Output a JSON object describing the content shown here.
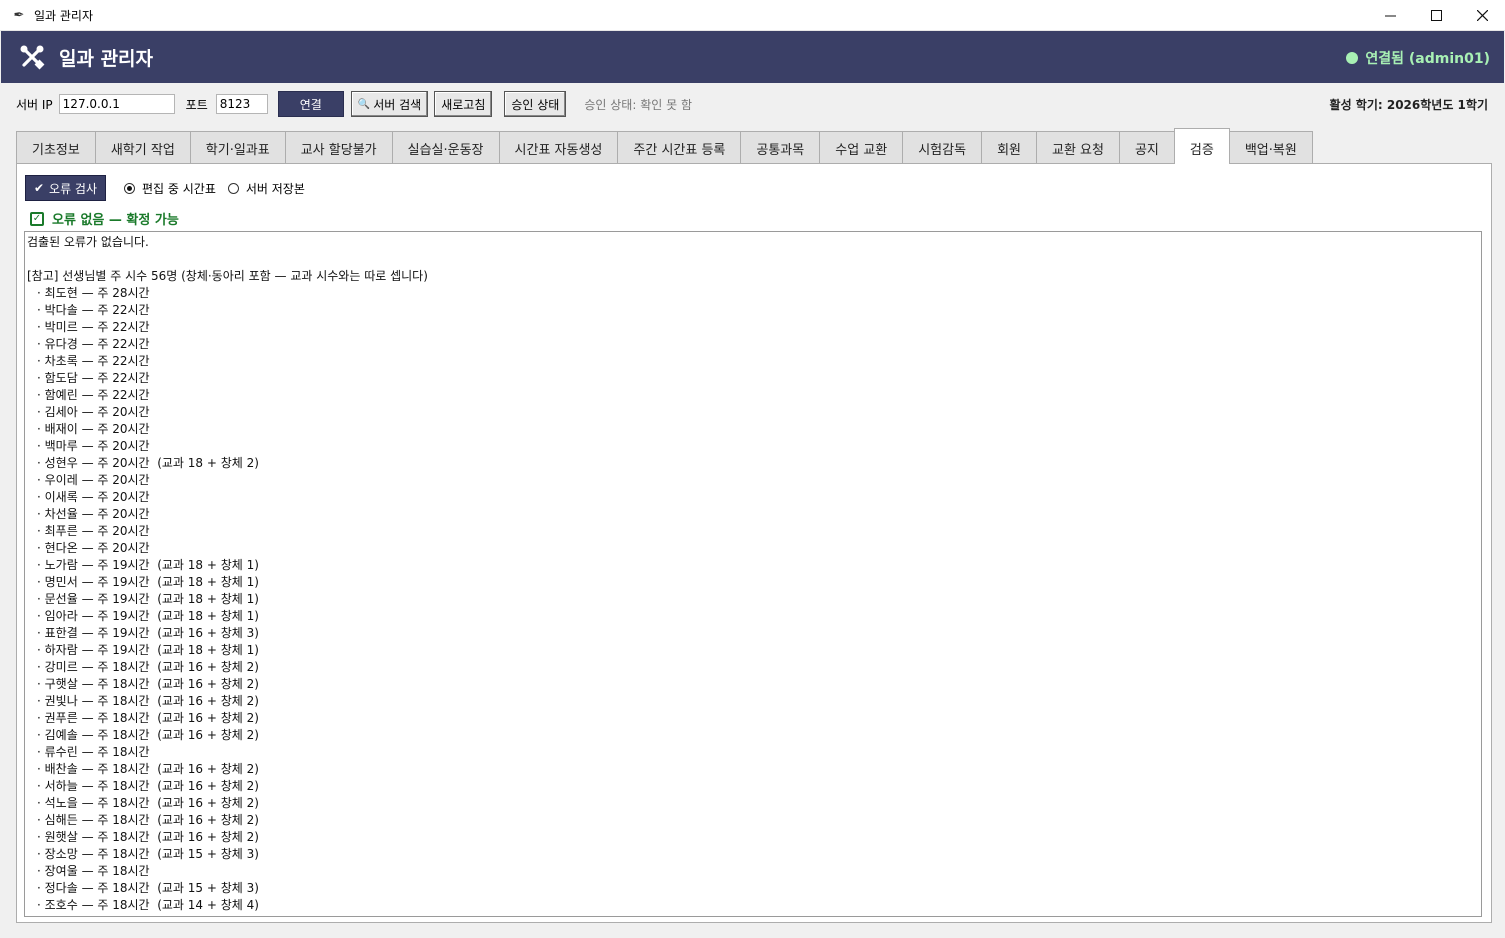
{
  "window": {
    "title": "일과 관리자",
    "icons": {
      "app": "feather-icon",
      "minimize": "minimize-icon",
      "maximize": "maximize-icon",
      "close": "close-icon"
    }
  },
  "header": {
    "title": "일과 관리자",
    "logo_icon": "tools-icon",
    "status": "연결됨 (admin01)",
    "status_color": "#a8f0b4",
    "bg_color": "#3a3f66"
  },
  "toolbar": {
    "server_ip_label": "서버 IP",
    "server_ip_value": "127.0.0.1",
    "port_label": "포트",
    "port_value": "8123",
    "connect_label": "연결",
    "search_server_label": "서버 검색",
    "refresh_label": "새로고침",
    "approval_button_label": "승인 상태",
    "approval_status": "승인 상태: 확인 못 함",
    "active_semester": "활성 학기: 2026학년도 1학기"
  },
  "tabs": [
    {
      "label": "기초정보"
    },
    {
      "label": "새학기 작업"
    },
    {
      "label": "학기·일과표"
    },
    {
      "label": "교사 할당불가"
    },
    {
      "label": "실습실·운동장"
    },
    {
      "label": "시간표 자동생성"
    },
    {
      "label": "주간 시간표 등록"
    },
    {
      "label": "공통과목"
    },
    {
      "label": "수업 교환"
    },
    {
      "label": "시험감독"
    },
    {
      "label": "회원"
    },
    {
      "label": "교환 요청"
    },
    {
      "label": "공지"
    },
    {
      "label": "검증"
    },
    {
      "label": "백업·복원"
    }
  ],
  "active_tab": "검증",
  "validation": {
    "check_button_label": "오류 검사",
    "radio_editing": "편집 중 시간표",
    "radio_server": "서버 저장본",
    "selected": "editing",
    "result_label": "오류 없음 — 확정 가능",
    "result_color": "#1a7a2a",
    "output_header": "검출된 오류가 없습니다.",
    "output_note": "[참고] 선생님별 주 시수 56명 (창체·동아리 포함 — 교과 시수와는 따로 셉니다)",
    "output_lines": [
      "· 최도현 — 주 28시간",
      "· 박다솔 — 주 22시간",
      "· 박미르 — 주 22시간",
      "· 유다경 — 주 22시간",
      "· 차초록 — 주 22시간",
      "· 함도담 — 주 22시간",
      "· 함예린 — 주 22시간",
      "· 김세아 — 주 20시간",
      "· 배재이 — 주 20시간",
      "· 백마루 — 주 20시간",
      "· 성현우 — 주 20시간  (교과 18 + 창체 2)",
      "· 우이레 — 주 20시간",
      "· 이새록 — 주 20시간",
      "· 차선율 — 주 20시간",
      "· 최푸른 — 주 20시간",
      "· 현다온 — 주 20시간",
      "· 노가람 — 주 19시간  (교과 18 + 창체 1)",
      "· 명민서 — 주 19시간  (교과 18 + 창체 1)",
      "· 문선율 — 주 19시간  (교과 18 + 창체 1)",
      "· 임아라 — 주 19시간  (교과 18 + 창체 1)",
      "· 표한결 — 주 19시간  (교과 16 + 창체 3)",
      "· 하자람 — 주 19시간  (교과 18 + 창체 1)",
      "· 강미르 — 주 18시간  (교과 16 + 창체 2)",
      "· 구햇살 — 주 18시간  (교과 16 + 창체 2)",
      "· 권빛나 — 주 18시간  (교과 16 + 창체 2)",
      "· 권푸른 — 주 18시간  (교과 16 + 창체 2)",
      "· 김예솔 — 주 18시간  (교과 16 + 창체 2)",
      "· 류수린 — 주 18시간",
      "· 배찬솔 — 주 18시간  (교과 16 + 창체 2)",
      "· 서하늘 — 주 18시간  (교과 16 + 창체 2)",
      "· 석노을 — 주 18시간  (교과 16 + 창체 2)",
      "· 심해든 — 주 18시간  (교과 16 + 창체 2)",
      "· 원햇살 — 주 18시간  (교과 16 + 창체 2)",
      "· 장소망 — 주 18시간  (교과 15 + 창체 3)",
      "· 장여울 — 주 18시간",
      "· 정다솔 — 주 18시간  (교과 15 + 창체 3)",
      "· 조호수 — 주 18시간  (교과 14 + 창체 4)"
    ]
  }
}
